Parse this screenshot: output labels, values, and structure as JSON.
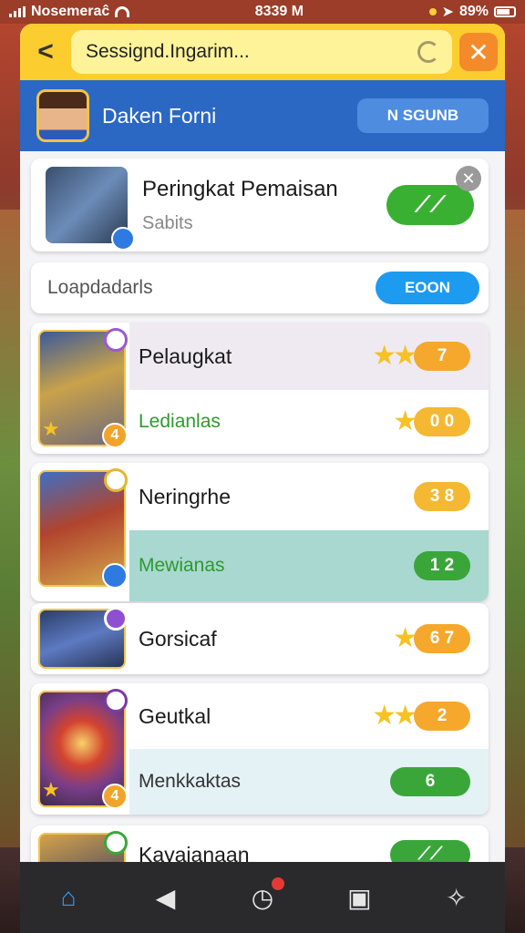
{
  "status_bar": {
    "carrier": "Nosemeraĉ",
    "time": "8339 M",
    "battery": "89%"
  },
  "header": {
    "title": "Sessignd.Ingarim...",
    "back_label": "<",
    "close_label": "✕"
  },
  "user": {
    "name": "Daken Forni",
    "action_label": "N SGUNB"
  },
  "promo": {
    "title": "Peringkat Pemaisan",
    "subtitle": "Sabits",
    "cta_label": "⟋⟋"
  },
  "tabs": {
    "label": "Loapdadarls",
    "button_label": "EOON"
  },
  "leaderboard": [
    {
      "name": "Pelaugkat",
      "sub": "Ledianlas",
      "primary_score": "7",
      "primary_stars": 2,
      "secondary_score": "0 0",
      "secondary_stars": 1,
      "thumb_badge": "4"
    },
    {
      "name": "Neringrhe",
      "sub": "Mewianas",
      "primary_score": "3 8",
      "primary_stars": 0,
      "secondary_score": "1 2",
      "secondary_stars": 0,
      "thumb_badge": ""
    },
    {
      "name": "Gorsicaf",
      "sub": "",
      "primary_score": "6 7",
      "primary_stars": 1
    },
    {
      "name": "Geutkal",
      "sub": "Menkkaktas",
      "primary_score": "2",
      "primary_stars": 2,
      "secondary_score": "6",
      "secondary_stars": 0,
      "thumb_badge": "4"
    },
    {
      "name": "Kayajanaan"
    }
  ],
  "colors": {
    "header": "#fbcd2f",
    "userbar": "#2a68c4",
    "accent_green": "#39b032",
    "accent_orange": "#f5a82c"
  }
}
